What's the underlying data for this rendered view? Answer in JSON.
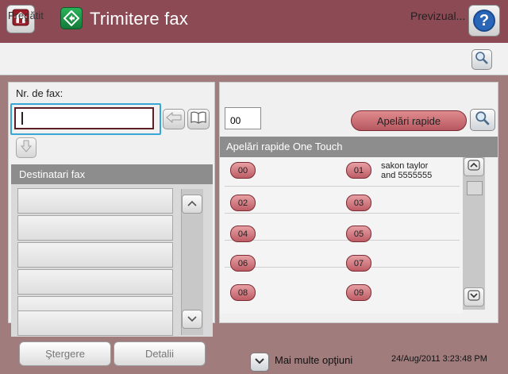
{
  "header": {
    "title": "Trimitere fax"
  },
  "status": {
    "text": "Pregătit",
    "preview_label": "Previzual..."
  },
  "fax": {
    "label": "Nr. de fax:",
    "value": ""
  },
  "recipients": {
    "header": "Destinatari fax",
    "rows": [
      "",
      "",
      "",
      "",
      "",
      ""
    ]
  },
  "buttons": {
    "delete": "Ştergere",
    "details": "Detalii",
    "speed_dials": "Apelări rapide"
  },
  "speed_dial": {
    "input_value": "00",
    "list_header": "Apelări rapide One Touch",
    "entries": [
      {
        "key": "00",
        "name": ""
      },
      {
        "key": "01",
        "name": "sakon taylor and 5555555"
      },
      {
        "key": "02",
        "name": ""
      },
      {
        "key": "03",
        "name": ""
      },
      {
        "key": "04",
        "name": ""
      },
      {
        "key": "05",
        "name": ""
      },
      {
        "key": "06",
        "name": ""
      },
      {
        "key": "07",
        "name": ""
      },
      {
        "key": "08",
        "name": ""
      },
      {
        "key": "09",
        "name": ""
      }
    ]
  },
  "footer": {
    "more_options": "Mai multe opţiuni",
    "timestamp": "24/Aug/2011 3:23:48 PM"
  },
  "icons": {
    "home": "home-icon",
    "app": "fax-send-icon",
    "help": "help-icon",
    "preview": "magnifier-icon",
    "backspace": "backspace-arrow-icon",
    "address_book": "address-book-icon",
    "move_down": "down-arrow-icon",
    "scroll_up": "chevron-up-icon",
    "scroll_down": "chevron-down-icon"
  },
  "colors": {
    "header_bg": "#8c4a54",
    "page_bg": "#a07c7c",
    "accent_button": "#c96d74",
    "input_focus": "#38a7d6"
  }
}
